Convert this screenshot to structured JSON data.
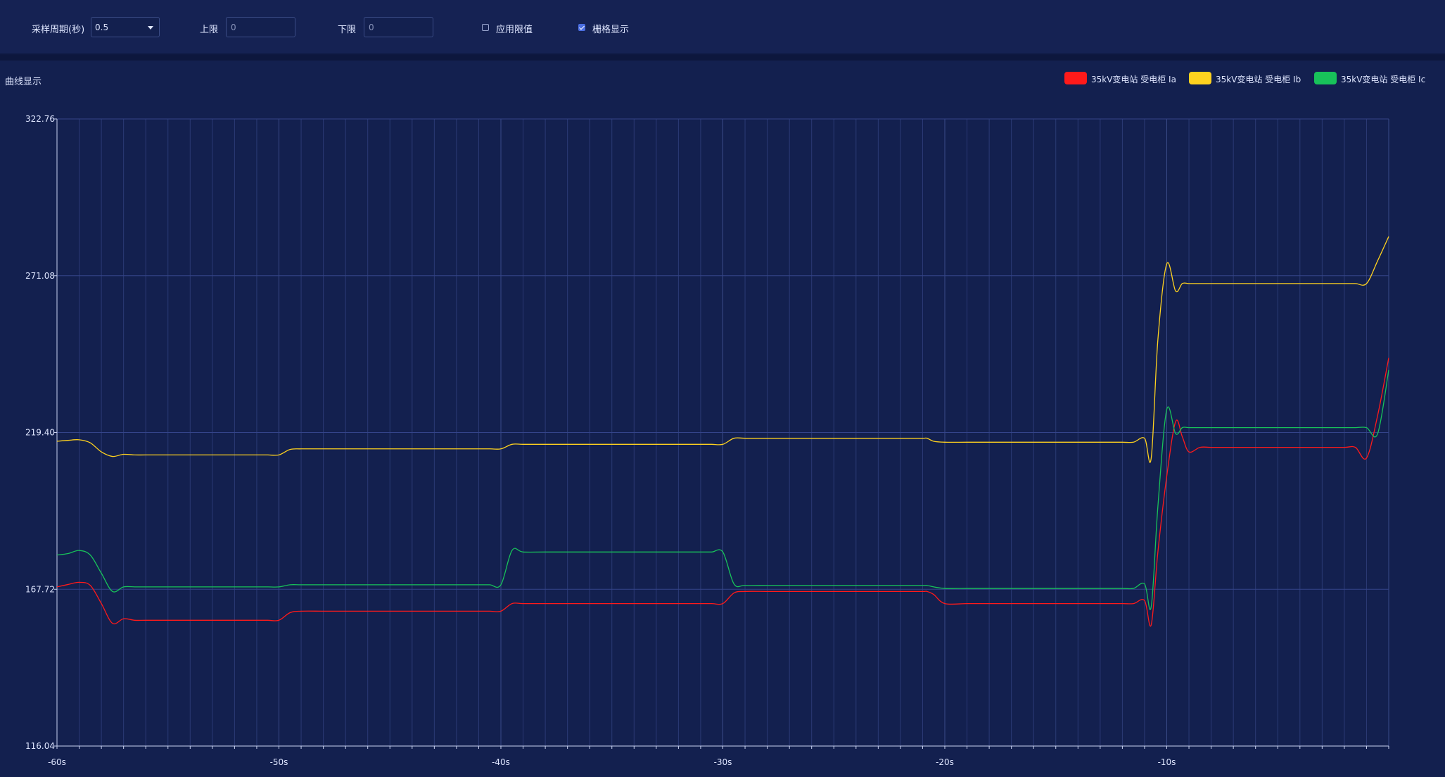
{
  "toolbar": {
    "period_label": "采样周期(秒)",
    "period_value": "0.5",
    "upper_label": "上限",
    "upper_value": "0",
    "lower_label": "下限",
    "lower_value": "0",
    "apply_limit_label": "应用限值",
    "apply_limit_checked": false,
    "grid_label": "栅格显示",
    "grid_checked": true
  },
  "section_title": "曲线显示",
  "legend": [
    {
      "label": "35kV变电站  受电柜  Ia",
      "color": "#ff1a1a"
    },
    {
      "label": "35kV变电站  受电柜  Ib",
      "color": "#ffd21f"
    },
    {
      "label": "35kV变电站  受电柜  Ic",
      "color": "#18c25a"
    }
  ],
  "chart_data": {
    "type": "line",
    "xlabel": "",
    "ylabel": "",
    "xlim": [
      -60,
      0
    ],
    "ylim": [
      116.04,
      322.76
    ],
    "x_ticks": [
      -60,
      -50,
      -40,
      -30,
      -20,
      -10
    ],
    "x_tick_labels": [
      "-60s",
      "-50s",
      "-40s",
      "-30s",
      "-20s",
      "-10s"
    ],
    "y_ticks": [
      116.04,
      167.72,
      219.4,
      271.08,
      322.76
    ],
    "y_tick_labels": [
      "116.04",
      "167.72",
      "219.40",
      "271.08",
      "322.76"
    ],
    "grid": true,
    "legend_position": "top-right",
    "series": [
      {
        "name": "35kV变电站  受电柜  Ia",
        "color": "#ff1a1a",
        "x": [
          -60,
          -59.5,
          -59,
          -58.5,
          -58,
          -57.5,
          -57,
          -56.5,
          -56,
          -55,
          -54,
          -53,
          -52,
          -51,
          -50.5,
          -50,
          -49.5,
          -49,
          -48,
          -47,
          -46,
          -45,
          -44,
          -43,
          -42,
          -41,
          -40.5,
          -40,
          -39.5,
          -39,
          -38,
          -37,
          -36,
          -35,
          -34,
          -33,
          -32,
          -31,
          -30.5,
          -30,
          -29.5,
          -29,
          -28,
          -27,
          -26,
          -25,
          -24,
          -23,
          -22,
          -21,
          -20.8,
          -20.5,
          -20,
          -19,
          -18,
          -17,
          -16,
          -15,
          -14,
          -13,
          -12,
          -11.5,
          -11,
          -10.7,
          -10.4,
          -10,
          -9.6,
          -9.3,
          -9,
          -8.5,
          -8,
          -7,
          -6,
          -5,
          -4,
          -3,
          -2,
          -1.5,
          -1,
          -0.5,
          0
        ],
        "y": [
          168.5,
          169.3,
          170.0,
          169.0,
          163.0,
          156.5,
          158.0,
          157.5,
          157.5,
          157.5,
          157.5,
          157.5,
          157.5,
          157.5,
          157.5,
          157.5,
          160.0,
          160.5,
          160.5,
          160.5,
          160.5,
          160.5,
          160.5,
          160.5,
          160.5,
          160.5,
          160.5,
          160.5,
          163.0,
          163.0,
          163.0,
          163.0,
          163.0,
          163.0,
          163.0,
          163.0,
          163.0,
          163.0,
          163.0,
          163.0,
          166.5,
          167.0,
          167.0,
          167.0,
          167.0,
          167.0,
          167.0,
          167.0,
          167.0,
          167.0,
          167.0,
          166.0,
          163.0,
          163.0,
          163.0,
          163.0,
          163.0,
          163.0,
          163.0,
          163.0,
          163.0,
          163.0,
          164.0,
          156.0,
          180.0,
          205.0,
          223.0,
          218.0,
          213.0,
          214.5,
          214.5,
          214.5,
          214.5,
          214.5,
          214.5,
          214.5,
          214.5,
          214.5,
          211.0,
          225.0,
          244.0
        ]
      },
      {
        "name": "35kV变电站  受电柜  Ib",
        "color": "#ffd21f",
        "x": [
          -60,
          -59.5,
          -59,
          -58.5,
          -58,
          -57.5,
          -57,
          -56.5,
          -56,
          -55,
          -54,
          -53,
          -52,
          -51,
          -50.5,
          -50,
          -49.5,
          -49,
          -48,
          -47,
          -46,
          -45,
          -44,
          -43,
          -42,
          -41,
          -40.5,
          -40,
          -39.5,
          -39,
          -38,
          -37,
          -36,
          -35,
          -34,
          -33,
          -32,
          -31,
          -30.5,
          -30,
          -29.5,
          -29,
          -28,
          -27,
          -26,
          -25,
          -24,
          -23,
          -22,
          -21,
          -20.8,
          -20.5,
          -20,
          -19,
          -18,
          -17,
          -16,
          -15,
          -14,
          -13,
          -12,
          -11.5,
          -11,
          -10.7,
          -10.4,
          -10,
          -9.6,
          -9.3,
          -9,
          -8.5,
          -8,
          -7,
          -6,
          -5,
          -4,
          -3,
          -2,
          -1.5,
          -1,
          -0.5,
          0
        ],
        "y": [
          216.5,
          216.8,
          217.0,
          216.0,
          213.0,
          211.5,
          212.2,
          212.0,
          212.0,
          212.0,
          212.0,
          212.0,
          212.0,
          212.0,
          212.0,
          212.0,
          213.8,
          214.0,
          214.0,
          214.0,
          214.0,
          214.0,
          214.0,
          214.0,
          214.0,
          214.0,
          214.0,
          214.0,
          215.5,
          215.5,
          215.5,
          215.5,
          215.5,
          215.5,
          215.5,
          215.5,
          215.5,
          215.5,
          215.5,
          215.5,
          217.5,
          217.5,
          217.5,
          217.5,
          217.5,
          217.5,
          217.5,
          217.5,
          217.5,
          217.5,
          217.5,
          216.5,
          216.2,
          216.2,
          216.2,
          216.2,
          216.2,
          216.2,
          216.2,
          216.2,
          216.2,
          216.2,
          217.5,
          211.0,
          250.0,
          275.0,
          266.0,
          268.5,
          268.5,
          268.5,
          268.5,
          268.5,
          268.5,
          268.5,
          268.5,
          268.5,
          268.5,
          268.5,
          268.5,
          276.0,
          284.0
        ]
      },
      {
        "name": "35kV变电站  受电柜  Ic",
        "color": "#18c25a",
        "x": [
          -60,
          -59.5,
          -59,
          -58.5,
          -58,
          -57.5,
          -57,
          -56.5,
          -56,
          -55,
          -54,
          -53,
          -52,
          -51,
          -50.5,
          -50,
          -49.5,
          -49,
          -48,
          -47,
          -46,
          -45,
          -44,
          -43,
          -42,
          -41,
          -40.5,
          -40,
          -39.5,
          -39,
          -38,
          -37,
          -36,
          -35,
          -34,
          -33,
          -32,
          -31,
          -30.5,
          -30,
          -29.5,
          -29,
          -28,
          -27,
          -26,
          -25,
          -24,
          -23,
          -22,
          -21,
          -20.8,
          -20.5,
          -20,
          -19,
          -18,
          -17,
          -16,
          -15,
          -14,
          -13,
          -12,
          -11.5,
          -11,
          -10.7,
          -10.4,
          -10,
          -9.6,
          -9.3,
          -9,
          -8.5,
          -8,
          -7,
          -6,
          -5,
          -4,
          -3,
          -2,
          -1.5,
          -1,
          -0.5,
          0
        ],
        "y": [
          179.0,
          179.5,
          180.5,
          179.0,
          173.0,
          167.0,
          168.5,
          168.5,
          168.5,
          168.5,
          168.5,
          168.5,
          168.5,
          168.5,
          168.5,
          168.5,
          169.2,
          169.2,
          169.2,
          169.2,
          169.2,
          169.2,
          169.2,
          169.2,
          169.2,
          169.2,
          169.2,
          169.2,
          180.5,
          180.0,
          180.0,
          180.0,
          180.0,
          180.0,
          180.0,
          180.0,
          180.0,
          180.0,
          180.0,
          180.0,
          169.5,
          169.0,
          169.0,
          169.0,
          169.0,
          169.0,
          169.0,
          169.0,
          169.0,
          169.0,
          169.0,
          168.5,
          168.0,
          168.0,
          168.0,
          168.0,
          168.0,
          168.0,
          168.0,
          168.0,
          168.0,
          168.0,
          169.5,
          162.0,
          195.0,
          227.0,
          219.0,
          221.0,
          221.0,
          221.0,
          221.0,
          221.0,
          221.0,
          221.0,
          221.0,
          221.0,
          221.0,
          221.0,
          221.0,
          219.0,
          240.0
        ]
      }
    ]
  }
}
